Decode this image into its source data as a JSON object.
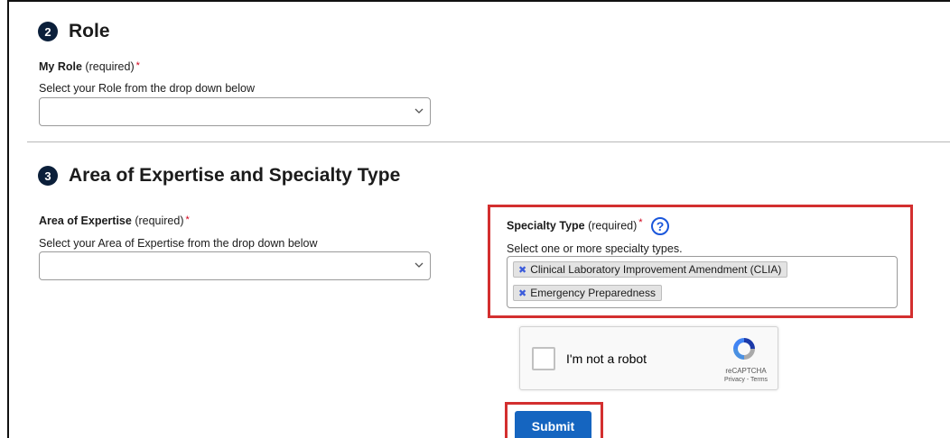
{
  "role_section": {
    "step": "2",
    "title": "Role",
    "field_label": "My Role",
    "field_qualifier": "(required)",
    "required_mark": "*",
    "hint": "Select your Role from the drop down below",
    "selected_value": ""
  },
  "expertise_section": {
    "step": "3",
    "title": "Area of Expertise and Specialty Type",
    "area": {
      "field_label": "Area of Expertise",
      "field_qualifier": "(required)",
      "required_mark": "*",
      "hint": "Select your Area of Expertise from the drop down below",
      "selected_value": ""
    },
    "specialty": {
      "field_label": "Specialty Type",
      "field_qualifier": "(required)",
      "required_mark": "*",
      "help_glyph": "?",
      "hint": "Select one or more specialty types.",
      "selected_items": [
        {
          "label": "Clinical Laboratory Improvement Amendment (CLIA)",
          "remove_glyph": "✖"
        },
        {
          "label": "Emergency Preparedness",
          "remove_glyph": "✖"
        }
      ]
    }
  },
  "recaptcha": {
    "label": "I'm not a robot",
    "brand": "reCAPTCHA",
    "links": "Privacy - Terms"
  },
  "submit": {
    "label": "Submit"
  },
  "colors": {
    "highlight": "#d32f2f",
    "primary_button": "#1565c0",
    "badge": "#0b1f3a",
    "required": "#d0021b",
    "chip_remove": "#3b5bdb"
  },
  "icons": [
    "step-badge-2",
    "step-badge-3",
    "chevron-down-icon",
    "help-circle-icon",
    "chip-remove-icon",
    "recaptcha-logo-icon"
  ]
}
